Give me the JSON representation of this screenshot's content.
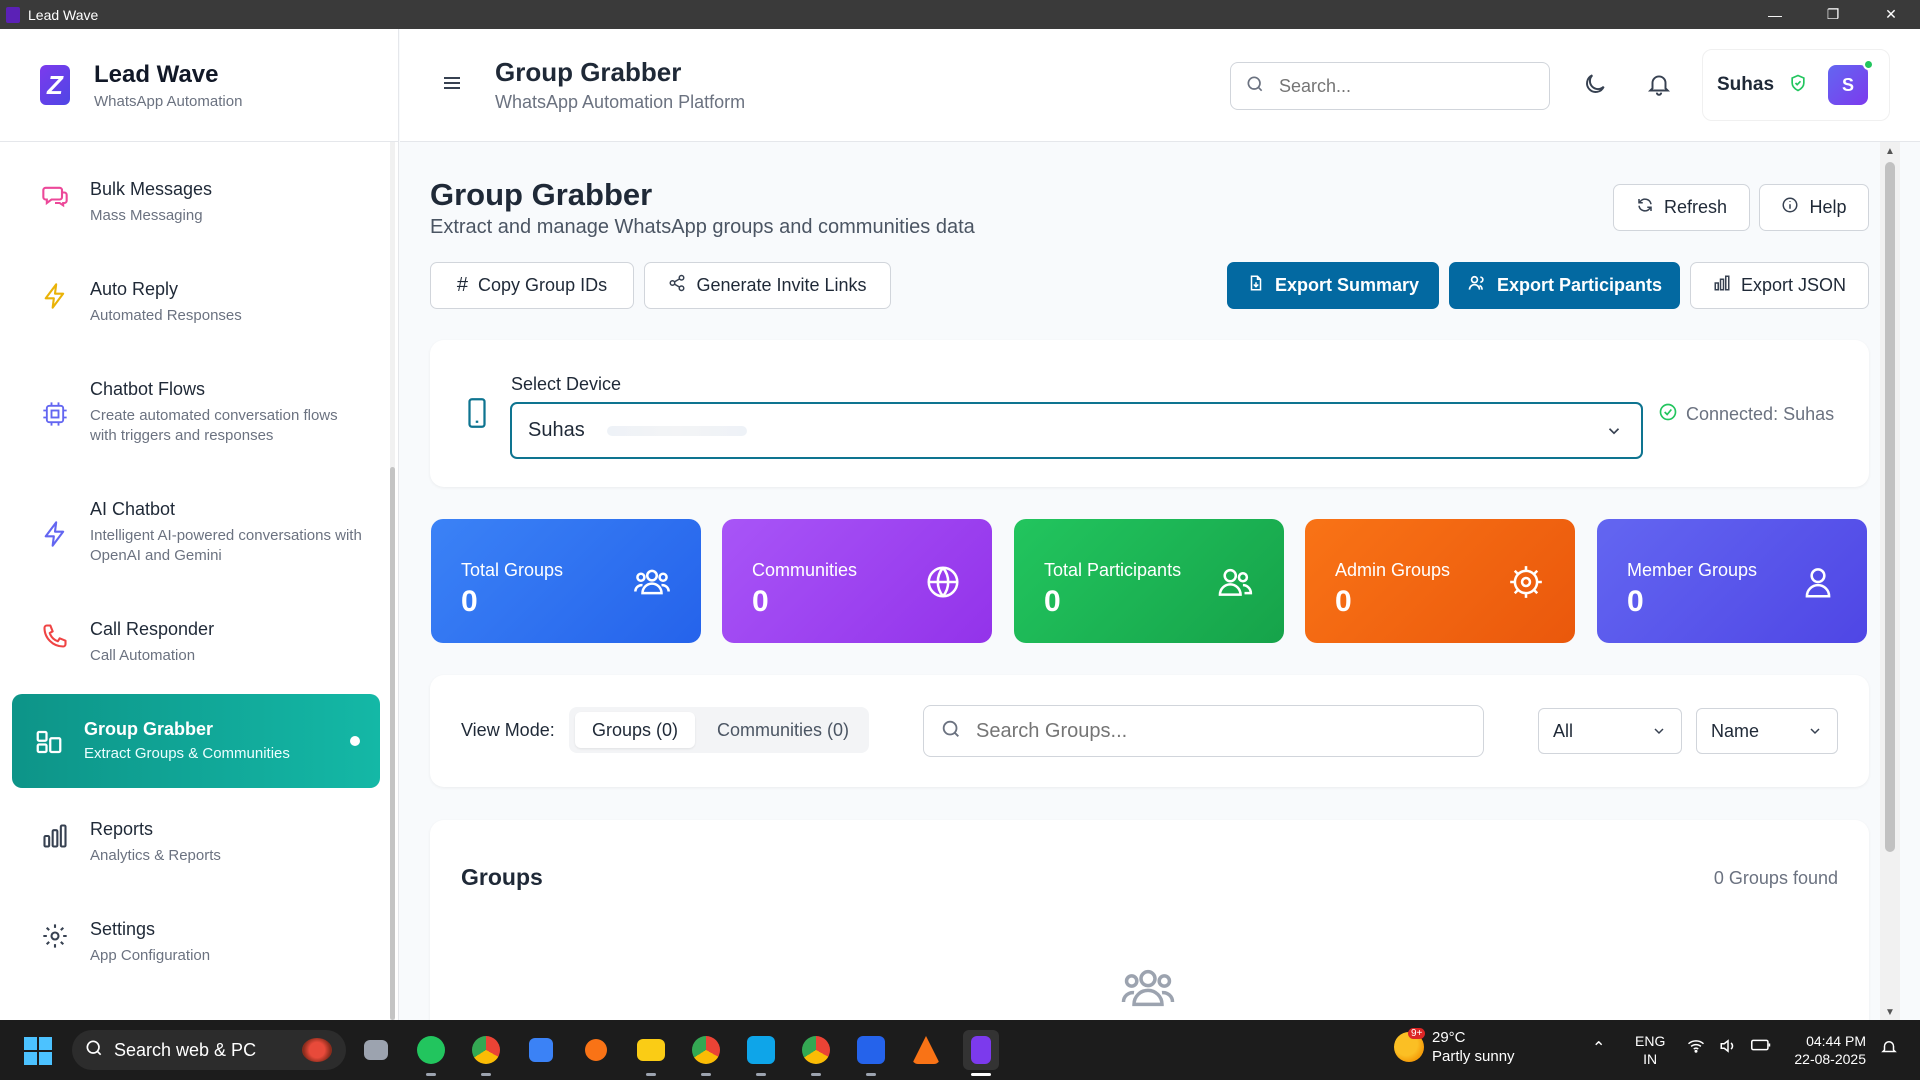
{
  "window": {
    "title": "Lead Wave",
    "controls": [
      "—",
      "❐",
      "✕"
    ]
  },
  "brand": {
    "name": "Lead Wave",
    "subtitle": "WhatsApp Automation"
  },
  "sidebar": {
    "items": [
      {
        "label": "Bulk Messages",
        "desc": "Mass Messaging",
        "icon": "message-icon",
        "color": "#ec4899"
      },
      {
        "label": "Auto Reply",
        "desc": "Automated Responses",
        "icon": "lightning-icon",
        "color": "#eab308"
      },
      {
        "label": "Chatbot Flows",
        "desc": "Create automated conversation flows with triggers and responses",
        "icon": "chip-icon",
        "color": "#6366f1"
      },
      {
        "label": "AI Chatbot",
        "desc": "Intelligent AI-powered conversations with OpenAI and Gemini",
        "icon": "bolt-icon",
        "color": "#6366f1"
      },
      {
        "label": "Call Responder",
        "desc": "Call Automation",
        "icon": "phone-icon",
        "color": "#ef4444"
      },
      {
        "label": "Group Grabber",
        "desc": "Extract Groups & Communities",
        "icon": "grid-icon",
        "active": true
      },
      {
        "label": "Reports",
        "desc": "Analytics & Reports",
        "icon": "bar-chart-icon",
        "color": "#374151"
      },
      {
        "label": "Settings",
        "desc": "App Configuration",
        "icon": "gear-icon",
        "color": "#374151"
      }
    ]
  },
  "header": {
    "title": "Group Grabber",
    "subtitle": "WhatsApp Automation Platform",
    "search_placeholder": "Search...",
    "user_name": "Suhas",
    "avatar_initial": "S"
  },
  "main": {
    "title": "Group Grabber",
    "subtitle": "Extract and manage WhatsApp groups and communities data",
    "refresh_label": "Refresh",
    "help_label": "Help",
    "copy_ids_label": "Copy Group IDs",
    "invite_links_label": "Generate Invite Links",
    "export_summary_label": "Export Summary",
    "export_participants_label": "Export Participants",
    "export_json_label": "Export JSON"
  },
  "device": {
    "label": "Select Device",
    "selected": "Suhas",
    "status": "Connected: Suhas"
  },
  "stats": [
    {
      "label": "Total Groups",
      "value": "0",
      "icon": "users-icon",
      "gradient": [
        "#3b82f6",
        "#2563eb"
      ]
    },
    {
      "label": "Communities",
      "value": "0",
      "icon": "globe-icon",
      "gradient": [
        "#a855f7",
        "#9333ea"
      ]
    },
    {
      "label": "Total Participants",
      "value": "0",
      "icon": "people-icon",
      "gradient": [
        "#22c55e",
        "#16a34a"
      ]
    },
    {
      "label": "Admin Groups",
      "value": "0",
      "icon": "settings-icon",
      "gradient": [
        "#f97316",
        "#ea580c"
      ]
    },
    {
      "label": "Member Groups",
      "value": "0",
      "icon": "user-icon",
      "gradient": [
        "#6366f1",
        "#4f46e5"
      ]
    }
  ],
  "filters": {
    "view_mode_label": "View Mode:",
    "tab_groups": "Groups (0)",
    "tab_communities": "Communities (0)",
    "search_placeholder": "Search Groups...",
    "type_filter": "All",
    "sort_by": "Name"
  },
  "groups": {
    "title": "Groups",
    "count_text": "0 Groups found"
  },
  "taskbar": {
    "search_label": "Search web & PC",
    "weather_temp": "29°C",
    "weather_desc": "Partly sunny",
    "weather_badge": "9+",
    "lang_line1": "ENG",
    "lang_line2": "IN",
    "time": "04:44 PM",
    "date": "22-08-2025"
  }
}
